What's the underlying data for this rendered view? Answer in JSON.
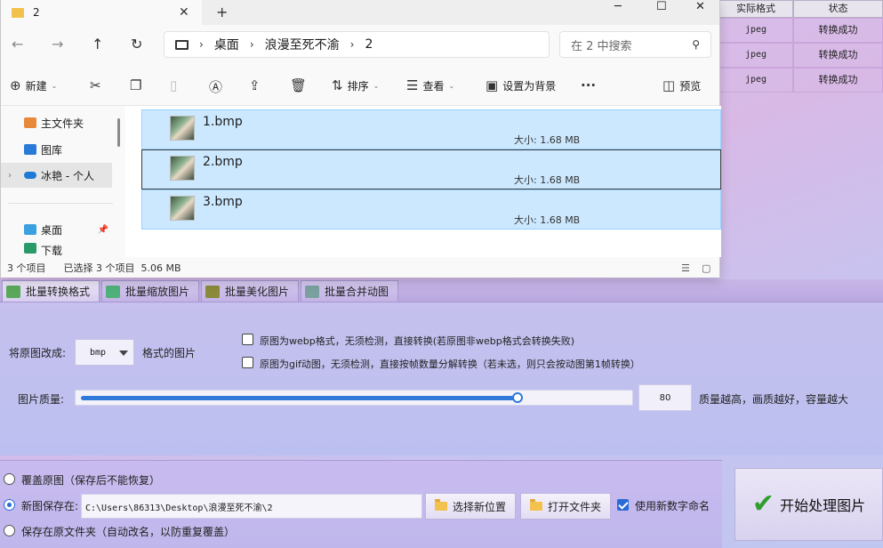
{
  "background_table": {
    "headers": [
      "实际格式",
      "状态"
    ],
    "rows": [
      {
        "format": "jpeg",
        "status": "转换成功"
      },
      {
        "format": "jpeg",
        "status": "转换成功"
      },
      {
        "format": "jpeg",
        "status": "转换成功"
      }
    ]
  },
  "explorer": {
    "tab_title": "2",
    "address": {
      "segments": [
        "桌面",
        "浪漫至死不渝",
        "2"
      ]
    },
    "search_placeholder": "在 2 中搜索",
    "toolbar": {
      "new": "新建",
      "sort": "排序",
      "view": "查看",
      "set_background": "设置为背景",
      "more": "···",
      "preview": "预览"
    },
    "sidebar": [
      {
        "label": "主文件夹"
      },
      {
        "label": "图库"
      },
      {
        "label": "冰艳 - 个人"
      },
      {
        "label": "桌面"
      },
      {
        "label": "下载"
      }
    ],
    "files": [
      {
        "name": "1.bmp",
        "size": "大小: 1.68 MB"
      },
      {
        "name": "2.bmp",
        "size": "大小: 1.68 MB"
      },
      {
        "name": "3.bmp",
        "size": "大小: 1.68 MB"
      }
    ],
    "status": {
      "count": "3 个项目",
      "selected": "已选择 3 个项目  5.06 MB"
    }
  },
  "app": {
    "tabs": [
      "批量转换格式",
      "批量缩放图片",
      "批量美化图片",
      "批量合并动图"
    ],
    "convert_label": "将原图改成:",
    "format_value": "bmp",
    "format_suffix": "格式的图片",
    "option_webp": "原图为webp格式，无须检测，直接转换(若原图非webp格式会转换失败)",
    "option_gif": "原图为gif动图，无须检测，直接按帧数量分解转换（若未选，则只会按动图第1帧转换）",
    "quality_label": "图片质量:",
    "quality_value": "80",
    "quality_fraction": 0.8,
    "quality_hint": "质量越高，画质越好，容量越大",
    "radio_overwrite": "覆盖原图（保存后不能恢复）",
    "radio_new": "新图保存在:",
    "save_path": "C:\\Users\\86313\\Desktop\\浪漫至死不渝\\2",
    "choose_location": "选择新位置",
    "open_folder": "打开文件夹",
    "use_numeric_name": "使用新数字命名",
    "radio_same_folder": "保存在原文件夹（自动改名，以防重复覆盖）",
    "start": "开始处理图片",
    "colors": {
      "accent": "#2f79d8",
      "check_green": "#2f9e2f"
    }
  }
}
